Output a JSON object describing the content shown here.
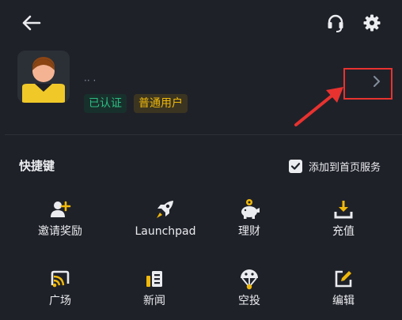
{
  "header": {
    "back_icon": "arrow-left-icon",
    "support_icon": "headset-icon",
    "settings_icon": "gear-icon"
  },
  "profile": {
    "username": "·· ·",
    "verified_badge": "已认证",
    "level_badge": "普通用户",
    "chevron_icon": "chevron-right-icon"
  },
  "shortcuts_section": {
    "title": "快捷键",
    "add_to_home_label": "添加到首页服务",
    "add_to_home_checked": true,
    "items": [
      {
        "label": "邀请奖励",
        "icon": "invite-user-icon"
      },
      {
        "label": "Launchpad",
        "icon": "rocket-icon"
      },
      {
        "label": "理财",
        "icon": "piggy-bank-icon"
      },
      {
        "label": "充值",
        "icon": "deposit-icon"
      },
      {
        "label": "广场",
        "icon": "square-feed-icon"
      },
      {
        "label": "新闻",
        "icon": "news-icon"
      },
      {
        "label": "空投",
        "icon": "airdrop-icon"
      },
      {
        "label": "编辑",
        "icon": "edit-icon"
      }
    ]
  },
  "colors": {
    "background": "#1f2129",
    "accent": "#f0b90b",
    "verified": "#2ebd85",
    "annotation": "#e8322f"
  }
}
